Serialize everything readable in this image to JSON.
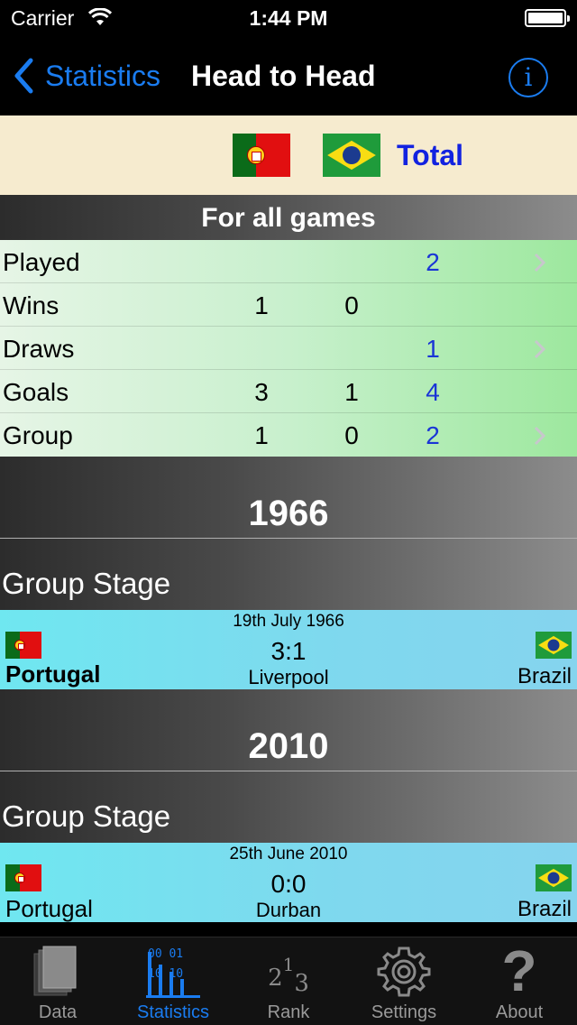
{
  "status_bar": {
    "carrier": "Carrier",
    "time": "1:44 PM"
  },
  "nav": {
    "back_label": "Statistics",
    "title": "Head to Head",
    "info_glyph": "i"
  },
  "teams_header": {
    "total_label": "Total",
    "team1_flag": "portugal-flag-icon",
    "team2_flag": "brazil-flag-icon"
  },
  "section_title": "For all games",
  "stats": [
    {
      "label": "Played",
      "team1": "",
      "team2": "",
      "total": "2",
      "chevron": true
    },
    {
      "label": "Wins",
      "team1": "1",
      "team2": "0",
      "total": "",
      "chevron": false
    },
    {
      "label": "Draws",
      "team1": "",
      "team2": "",
      "total": "1",
      "chevron": true
    },
    {
      "label": "Goals",
      "team1": "3",
      "team2": "1",
      "total": "4",
      "chevron": false
    },
    {
      "label": "Group",
      "team1": "1",
      "team2": "0",
      "total": "2",
      "chevron": true
    }
  ],
  "matches": [
    {
      "year": "1966",
      "stage": "Group Stage",
      "date": "19th July 1966",
      "score": "3:1",
      "venue": "Liverpool",
      "home": "Portugal",
      "away": "Brazil",
      "home_winner": true
    },
    {
      "year": "2010",
      "stage": "Group Stage",
      "date": "25th June 2010",
      "score": "0:0",
      "venue": "Durban",
      "home": "Portugal",
      "away": "Brazil",
      "home_winner": false
    }
  ],
  "tabs": [
    {
      "label": "Data",
      "icon": "data-icon",
      "active": false
    },
    {
      "label": "Statistics",
      "icon": "statistics-icon",
      "active": true
    },
    {
      "label": "Rank",
      "icon": "rank-icon",
      "active": false
    },
    {
      "label": "Settings",
      "icon": "gear-icon",
      "active": false
    },
    {
      "label": "About",
      "icon": "question-icon",
      "active": false
    }
  ],
  "colors": {
    "accent": "#1a7cf0",
    "total_blue": "#1222e0",
    "stat_value_blue": "#1a35d6",
    "header_cream": "#f6ebcf",
    "stats_green": "#9de89e",
    "match_cyan": "#7fd8ee"
  }
}
